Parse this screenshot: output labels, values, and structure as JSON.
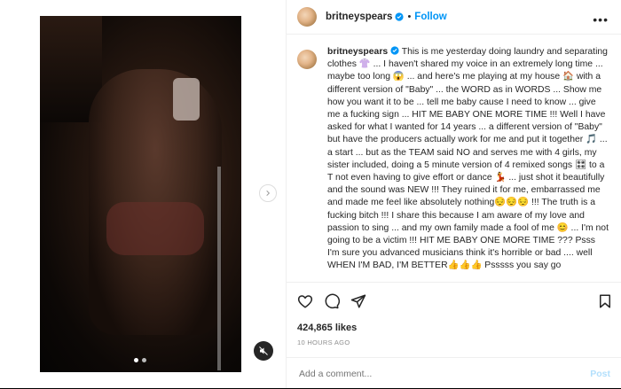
{
  "post": {
    "username": "britneyspears",
    "follow_label": "Follow",
    "dot": "•",
    "caption_user": "britneyspears",
    "caption": "This is me yesterday doing laundry and separating clothes 👚 ... I haven't shared my voice in an extremely long time ... maybe too long 😱 ... and here's me playing at my house 🏠 with a different version of \"Baby\" ... the WORD as in WORDS ... Show me how you want it to be ... tell me baby cause I need to know ... give me a fucking sign ... HIT ME BABY ONE MORE TIME !!! Well I have asked for what I wanted for 14 years ... a different version of \"Baby\" but have the producers actually work for me and put it together 🎵 ... a start ... but as the TEAM said NO and serves me with 4 girls, my sister included, doing a 5 minute version of 4 remixed songs 🎛 to a T not even having to give effort or dance 💃 ... just shot it beautifully and the sound was NEW !!! They ruined it for me, embarrassed me and made me feel like absolutely nothing😔😔😔 !!! The truth is a fucking bitch !!! I share this because I am aware of my love and passion to sing ... and my own family made a fool of me 😊 ... I'm not going to be a victim !!! HIT ME BABY ONE MORE TIME ??? Psss I'm sure you advanced musicians think it's horrible or bad .... well WHEN I'M BAD, I'M BETTER👍👍👍 Psssss you say go",
    "likes": "424,865 likes",
    "time": "10 HOURS AGO",
    "comment_placeholder": "Add a comment...",
    "post_label": "Post"
  },
  "colors": {
    "accent": "#0095f6",
    "post_disabled": "#b2dffc",
    "text": "#262626",
    "muted": "#8e8e8e"
  },
  "icons": [
    "more-icon",
    "verified-icon",
    "heart-icon",
    "comment-icon",
    "share-icon",
    "bookmark-icon",
    "mute-icon",
    "next-arrow-icon"
  ],
  "media": {
    "carousel_pages": 2,
    "active_page": 1
  }
}
